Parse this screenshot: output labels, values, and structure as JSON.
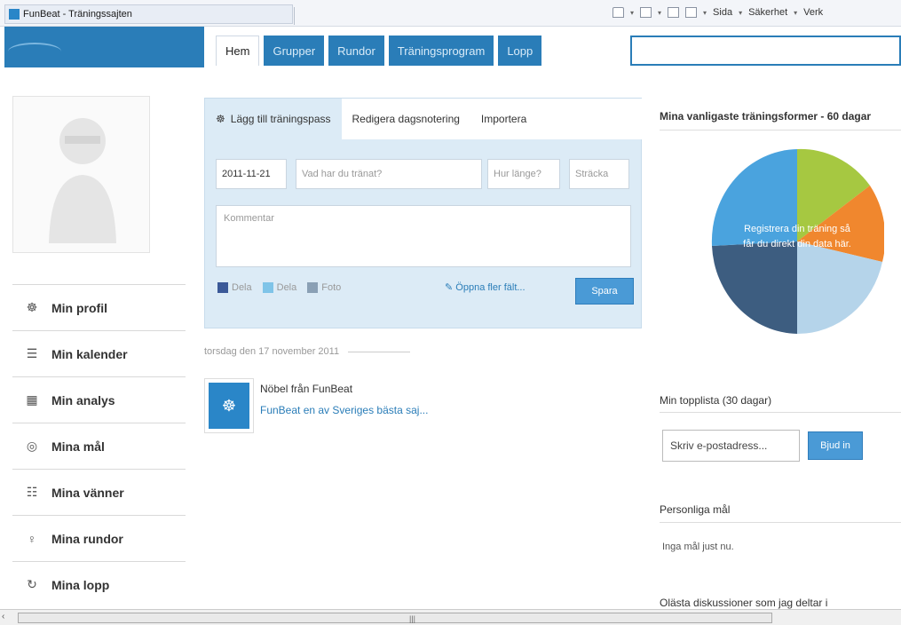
{
  "browser": {
    "tab_title": "FunBeat - Träningssajten",
    "commands": [
      "Sida",
      "Säkerhet",
      "Verk"
    ]
  },
  "nav": {
    "tabs": [
      "Hem",
      "Grupper",
      "Rundor",
      "Träningsprogram",
      "Lopp"
    ]
  },
  "sidebar": {
    "items": [
      {
        "label": "Min profil",
        "icon": "runner-icon",
        "glyph": "☸"
      },
      {
        "label": "Min kalender",
        "icon": "list-icon",
        "glyph": "☰"
      },
      {
        "label": "Min analys",
        "icon": "chart-icon",
        "glyph": "▦"
      },
      {
        "label": "Mina mål",
        "icon": "target-icon",
        "glyph": "◎"
      },
      {
        "label": "Mina vänner",
        "icon": "people-icon",
        "glyph": "☷"
      },
      {
        "label": "Mina rundor",
        "icon": "pin-icon",
        "glyph": "♀"
      },
      {
        "label": "Mina lopp",
        "icon": "loop-icon",
        "glyph": "↻"
      }
    ]
  },
  "post": {
    "tabs": [
      "Lägg till träningspass",
      "Redigera dagsnotering",
      "Importera"
    ],
    "date": "2011-11-21",
    "activity_placeholder": "Vad har du tränat?",
    "duration_placeholder": "Hur länge?",
    "distance_placeholder": "Sträcka",
    "comment_placeholder": "Kommentar",
    "share": [
      "Dela",
      "Dela",
      "Foto"
    ],
    "more_fields": "Öppna fler fält...",
    "save": "Spara"
  },
  "feed": {
    "date": "torsdag den 17 november 2011",
    "title": "Nöbel från FunBeat",
    "link": "FunBeat en av Sveriges bästa saj..."
  },
  "right": {
    "favorites_heading": "Mina vanligaste träningsformer - 60 dagar",
    "pie_text_1": "Registrera din träning så",
    "pie_text_2": "får du direkt din data här.",
    "toplist_heading": "Min topplista (30 dagar)",
    "toplist_placeholder": "Skriv e-postadress...",
    "toplist_button": "Bjud in",
    "goals_heading": "Personliga mål",
    "goals_text": "Inga mål just nu.",
    "discussions_heading": "Olästa diskussioner som jag deltar i"
  },
  "colors": {
    "brand_blue": "#2a7db8",
    "pie": [
      "#a6c841",
      "#f0872e",
      "#b5d4ea",
      "#3d5d80",
      "#4aa3de"
    ]
  }
}
